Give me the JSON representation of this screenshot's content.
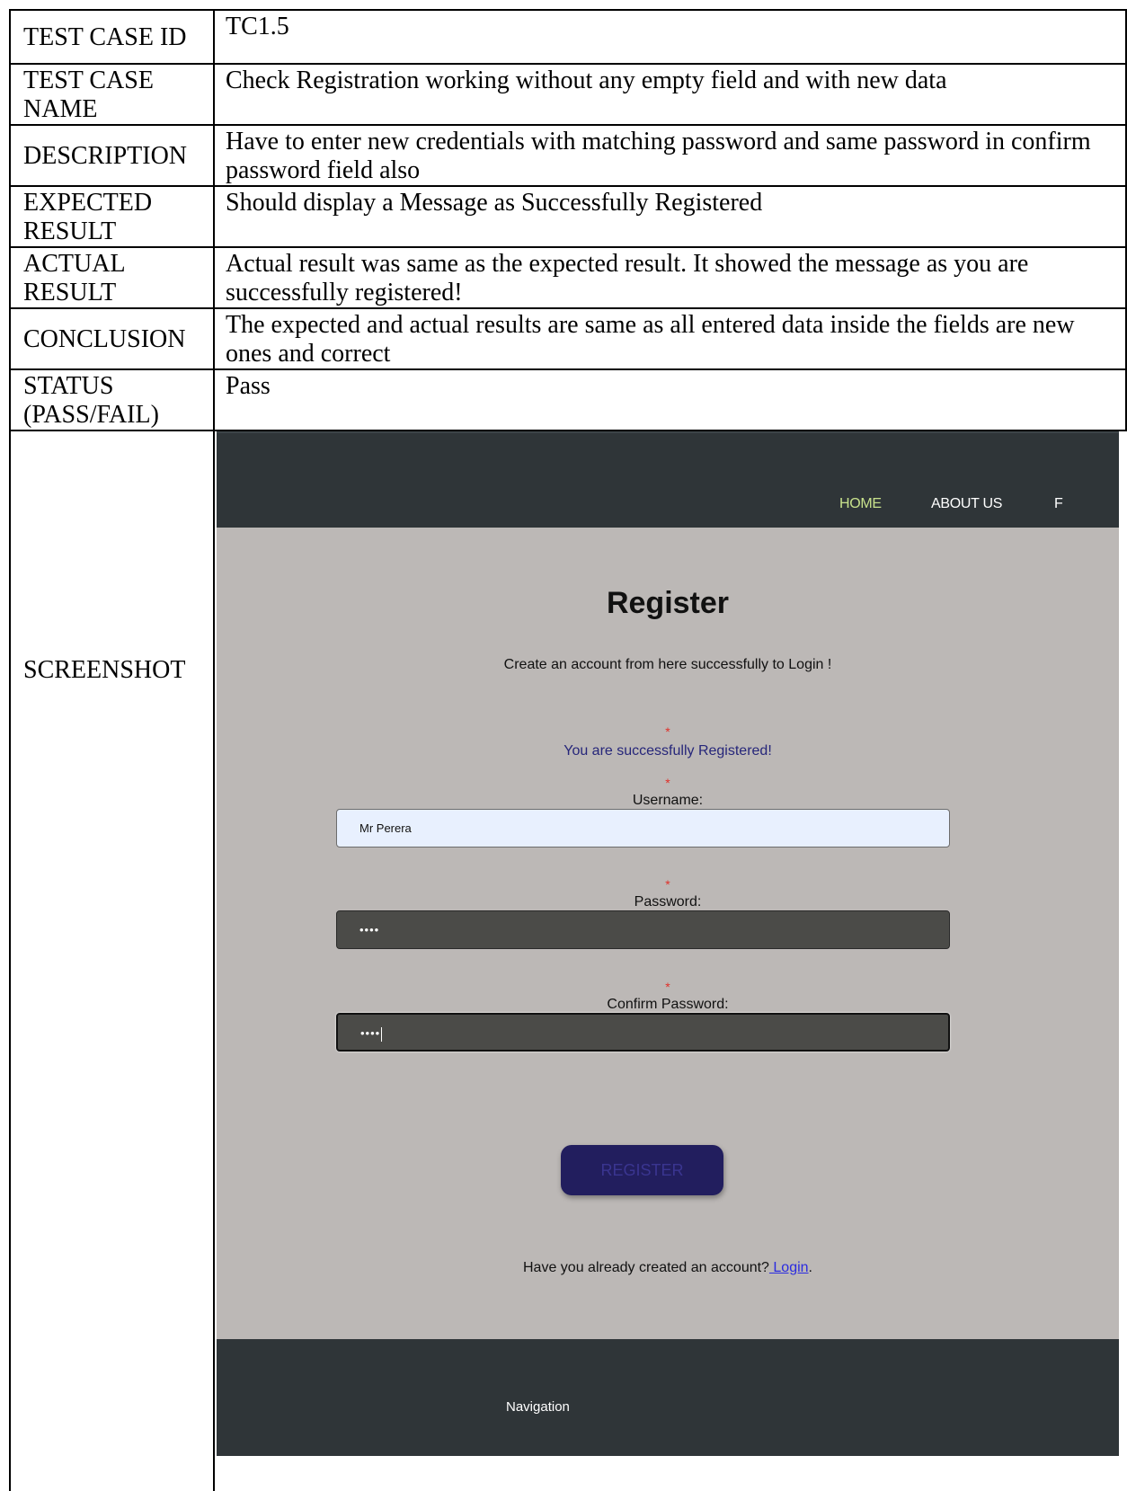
{
  "rows": [
    {
      "key": "TEST CASE ID",
      "value": "TC1.5"
    },
    {
      "key": "TEST CASE NAME",
      "value": "Check Registration working without any empty field and with new data"
    },
    {
      "key": "DESCRIPTION",
      "value": "Have to enter new credentials with matching password and same password in confirm password field also"
    },
    {
      "key": "EXPECTED RESULT",
      "value": "Should display a Message as Successfully Registered"
    },
    {
      "key": "ACTUAL RESULT",
      "value": "Actual result was same as the expected result. It showed the message as you are successfully registered!"
    },
    {
      "key": "CONCLUSION",
      "value": "The expected and actual results are same as all entered data inside the fields are new ones and correct"
    },
    {
      "key": "STATUS (PASS/FAIL)",
      "value": "Pass"
    }
  ],
  "screenshot_label": "SCREENSHOT",
  "screenshot": {
    "nav": {
      "home": "HOME",
      "about": "ABOUT US",
      "cut_item": "F"
    },
    "title": "Register",
    "subtitle": "Create an account from here successfully to Login !",
    "required_mark": "*",
    "success_message": "You are successfully Registered!",
    "username_label": "Username:",
    "username_value": "Mr Perera",
    "password_label": "Password:",
    "password_value": "••••",
    "confirm_label": "Confirm Password:",
    "confirm_value": "••••",
    "register_button": "REGISTER",
    "login_prompt": "Have you already created an account?",
    "login_link": " Login",
    "login_suffix": ".",
    "footer_navigation": "Navigation"
  },
  "colors": {
    "nav_bg": "#2f3538",
    "active_nav": "#c8e28c",
    "page_bg": "#bcb8b6",
    "button_bg": "#221e5e",
    "success_text": "#26267a",
    "required_star": "#e0302a",
    "link": "#2b2be0"
  }
}
